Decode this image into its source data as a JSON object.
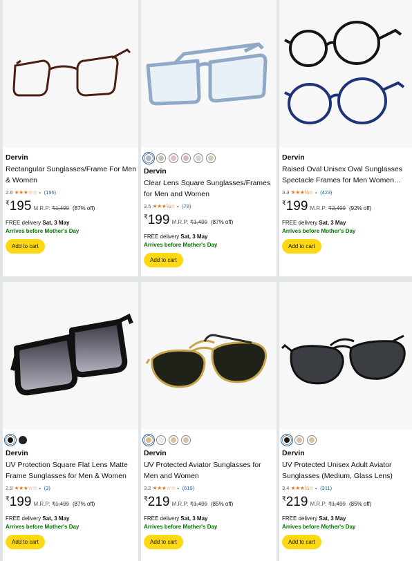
{
  "products": [
    {
      "brand": "Dervin",
      "title": "Rectangular Sunglasses/Frame For Men & Women",
      "rating": "2.8",
      "stars": "★★★☆☆",
      "reviews": "(195)",
      "currency": "₹",
      "price": "195",
      "mrp_label": "M.R.P:",
      "mrp": "₹1,499",
      "discount": "(87% off)",
      "delivery_prefix": "FREE delivery",
      "delivery_date": "Sat, 3 May",
      "arrival": "Arrives before Mother's Day",
      "cart_label": "Add to cart",
      "swatches": [],
      "image_icon": "brown-rectangular-frame"
    },
    {
      "brand": "Dervin",
      "title": "Clear Lens Square Sunglasses/Frames for Men and Women",
      "rating": "3.5",
      "stars": "★★★½☆",
      "reviews": "(78)",
      "currency": "₹",
      "price": "199",
      "mrp_label": "M.R.P:",
      "mrp": "₹1,499",
      "discount": "(87% off)",
      "delivery_prefix": "FREE delivery",
      "delivery_date": "Sat, 3 May",
      "arrival": "Arrives before Mother's Day",
      "cart_label": "Add to cart",
      "swatches": [
        "#a9b9cf",
        "#b7c9b3",
        "#e6bcc3",
        "#d6b7bc",
        "#cfd3d6",
        "#c8cdb7"
      ],
      "image_icon": "blue-transparent-square-frame"
    },
    {
      "brand": "Dervin",
      "title": "Raised Oval Unisex Oval Sunglasses Spectacle Frames for Men Women…",
      "rating": "3.3",
      "stars": "★★★½☆",
      "reviews": "(423)",
      "currency": "₹",
      "price": "199",
      "mrp_label": "M.R.P:",
      "mrp": "₹2,499",
      "discount": "(92% off)",
      "delivery_prefix": "FREE delivery",
      "delivery_date": "Sat, 3 May",
      "arrival": "Arrives before Mother's Day",
      "cart_label": "Add to cart",
      "swatches": [],
      "image_icon": "black-and-blue-oval-frames"
    },
    {
      "brand": "Dervin",
      "title": "UV Protection Square Flat Lens Matte Frame Sunglasses for Men & Women",
      "rating": "2.9",
      "stars": "★★★☆☆",
      "reviews": "(3)",
      "currency": "₹",
      "price": "199",
      "mrp_label": "M.R.P:",
      "mrp": "₹1,499",
      "discount": "(87% off)",
      "delivery_prefix": "FREE delivery",
      "delivery_date": "Sat, 3 May",
      "arrival": "Arrives before Mother's Day",
      "cart_label": "Add to cart",
      "swatches": [
        "#111111",
        "#222222"
      ],
      "image_icon": "black-square-sunglasses"
    },
    {
      "brand": "Dervin",
      "title": "UV Protected Aviator Sunglasses for Men and Women",
      "rating": "3.2",
      "stars": "★★★☆☆",
      "reviews": "(619)",
      "currency": "₹",
      "price": "219",
      "mrp_label": "M.R.P:",
      "mrp": "₹1,499",
      "discount": "(85% off)",
      "delivery_prefix": "FREE delivery",
      "delivery_date": "Sat, 3 May",
      "arrival": "Arrives before Mother's Day",
      "cart_label": "Add to cart",
      "swatches": [
        "#d9b98a",
        "#e9e9e9",
        "#d8c4a2",
        "#d2c7a1"
      ],
      "image_icon": "gold-aviator-sunglasses"
    },
    {
      "brand": "Dervin",
      "title": "UV Protected Unisex Adult Aviator Sunglasses (Medium, Glass Lens)",
      "rating": "3.4",
      "stars": "★★★½☆",
      "reviews": "(311)",
      "currency": "₹",
      "price": "219",
      "mrp_label": "M.R.P:",
      "mrp": "₹1,499",
      "discount": "(85% off)",
      "delivery_prefix": "FREE delivery",
      "delivery_date": "Sat, 3 May",
      "arrival": "Arrives before Mother's Day",
      "cart_label": "Add to cart",
      "swatches": [
        "#1c1c1c",
        "#d8c4a2",
        "#d2c7a1"
      ],
      "image_icon": "black-aviator-sunglasses"
    }
  ]
}
